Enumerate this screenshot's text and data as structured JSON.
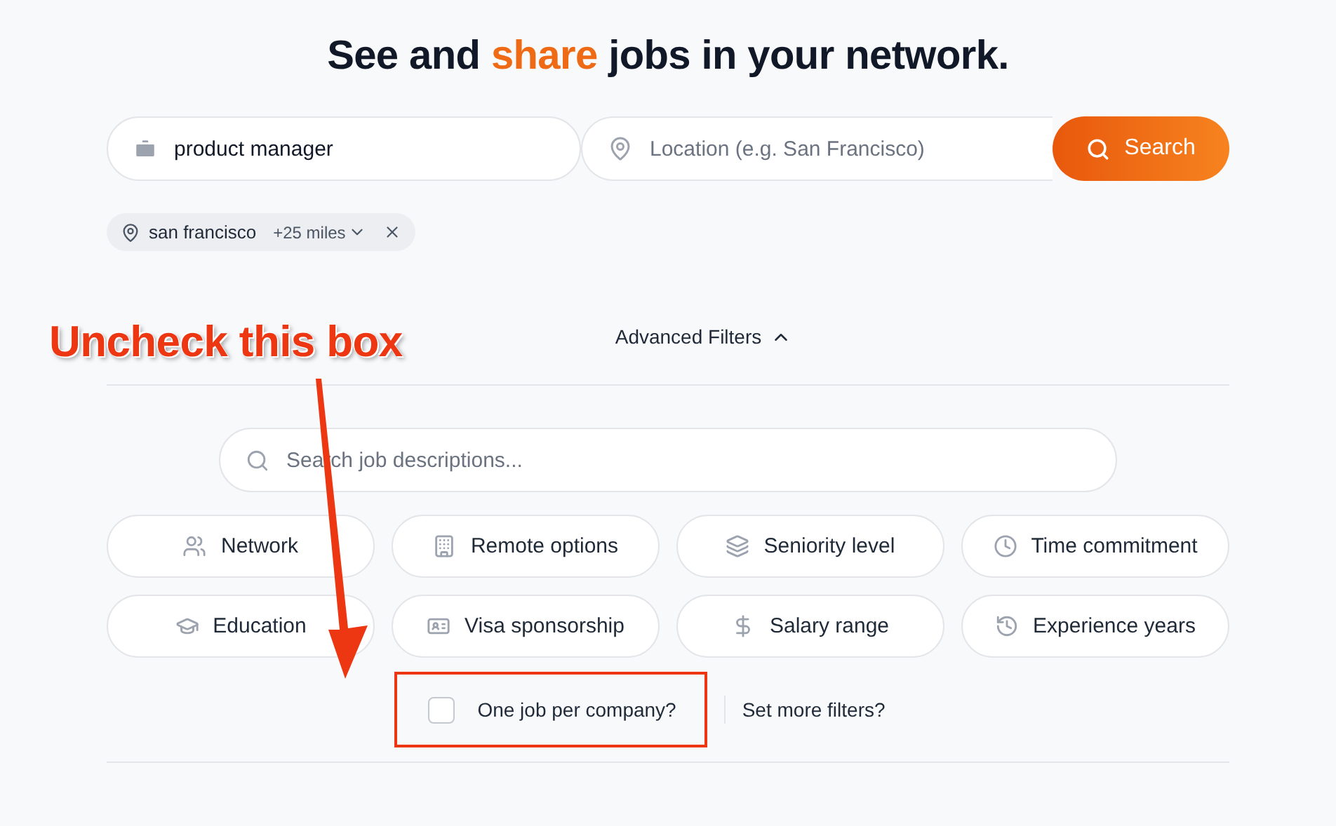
{
  "title": [
    {
      "text": "See and ",
      "accent": false
    },
    {
      "text": "share",
      "accent": true
    },
    {
      "text": " jobs in your network.",
      "accent": false
    }
  ],
  "search": {
    "keywords": {
      "value": "product manager"
    },
    "location": {
      "placeholder": "Location (e.g. San Francisco)"
    },
    "button": "Search"
  },
  "location_chip": {
    "label": "san francisco",
    "radius": "+25 miles"
  },
  "advanced_filters": {
    "label": "Advanced Filters",
    "expanded": true
  },
  "description_search": {
    "placeholder": "Search job descriptions..."
  },
  "filters": [
    {
      "label": "Network"
    },
    {
      "label": "Remote options"
    },
    {
      "label": "Seniority level"
    },
    {
      "label": "Time commitment"
    },
    {
      "label": "Education"
    },
    {
      "label": "Visa sponsorship"
    },
    {
      "label": "Salary range"
    },
    {
      "label": "Experience years"
    }
  ],
  "one_job_per_company": {
    "label": "One job per company?",
    "checked": false
  },
  "more_filters": "Set more filters?",
  "annotation": {
    "text": "Uncheck this box"
  }
}
